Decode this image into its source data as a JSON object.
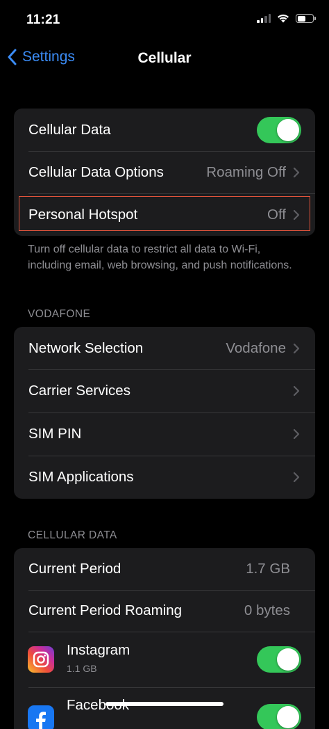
{
  "status_bar": {
    "time": "11:21"
  },
  "nav": {
    "back_label": "Settings",
    "title": "Cellular"
  },
  "group1": {
    "cellular_data": {
      "label": "Cellular Data",
      "enabled": true
    },
    "data_options": {
      "label": "Cellular Data Options",
      "value": "Roaming Off"
    },
    "hotspot": {
      "label": "Personal Hotspot",
      "value": "Off"
    }
  },
  "footer_note": "Turn off cellular data to restrict all data to Wi-Fi, including email, web browsing, and push notifications.",
  "carrier_section": {
    "header": "VODAFONE",
    "items": [
      {
        "label": "Network Selection",
        "value": "Vodafone"
      },
      {
        "label": "Carrier Services"
      },
      {
        "label": "SIM PIN"
      },
      {
        "label": "SIM Applications"
      }
    ]
  },
  "data_section": {
    "header": "CELLULAR DATA",
    "current_period": {
      "label": "Current Period",
      "value": "1.7 GB"
    },
    "current_period_roaming": {
      "label": "Current Period Roaming",
      "value": "0 bytes"
    },
    "apps": [
      {
        "name": "Instagram",
        "usage": "1.1 GB",
        "icon": "instagram-icon",
        "enabled": true
      },
      {
        "name": "Facebook",
        "usage": "",
        "icon": "facebook-icon",
        "enabled": true
      }
    ]
  },
  "colors": {
    "accent": "#3b8cf6",
    "toggle_on": "#34c759",
    "group_bg": "#1c1c1e",
    "secondary_text": "#8e8e93",
    "highlight_border": "#e0533b"
  }
}
